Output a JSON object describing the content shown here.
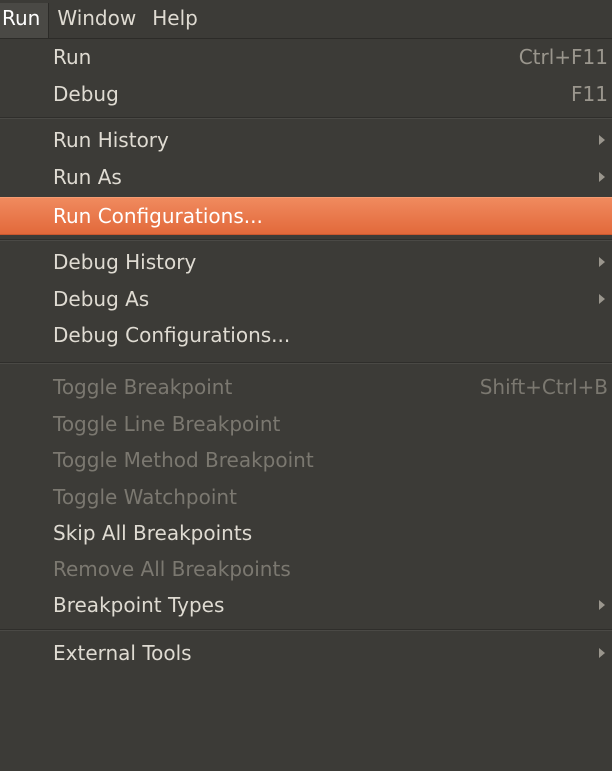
{
  "menubar": {
    "items": [
      {
        "label": "Run"
      },
      {
        "label": "Window"
      },
      {
        "label": "Help"
      }
    ]
  },
  "menu": {
    "run": {
      "label": "Run",
      "shortcut": "Ctrl+F11"
    },
    "debug": {
      "label": "Debug",
      "shortcut": "F11"
    },
    "run_history": {
      "label": "Run History"
    },
    "run_as": {
      "label": "Run As"
    },
    "run_configurations": {
      "label": "Run Configurations..."
    },
    "debug_history": {
      "label": "Debug History"
    },
    "debug_as": {
      "label": "Debug As"
    },
    "debug_configurations": {
      "label": "Debug Configurations..."
    },
    "toggle_breakpoint": {
      "label": "Toggle Breakpoint",
      "shortcut": "Shift+Ctrl+B"
    },
    "toggle_line_breakpoint": {
      "label": "Toggle Line Breakpoint"
    },
    "toggle_method_breakpoint": {
      "label": "Toggle Method Breakpoint"
    },
    "toggle_watchpoint": {
      "label": "Toggle Watchpoint"
    },
    "skip_all_breakpoints": {
      "label": "Skip All Breakpoints"
    },
    "remove_all_breakpoints": {
      "label": "Remove All Breakpoints"
    },
    "breakpoint_types": {
      "label": "Breakpoint Types"
    },
    "external_tools": {
      "label": "External Tools"
    }
  },
  "colors": {
    "highlight": "#e8734a",
    "menu_bg": "#3c3b37"
  }
}
